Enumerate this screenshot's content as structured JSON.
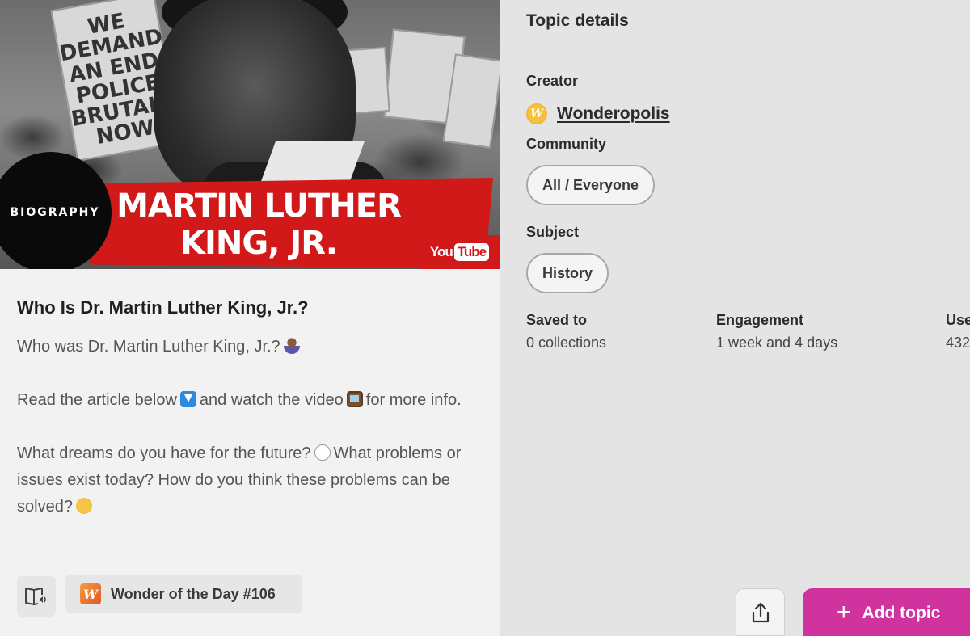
{
  "card": {
    "thumbnail": {
      "badge": "BIOGRAPHY",
      "banner_title": "MARTIN LUTHER KING, JR.",
      "youtube_you": "You",
      "youtube_tube": "Tube",
      "sign_text": "WE DEMAND AN END POLICE BRUTALITY NOW"
    },
    "title": "Who Is Dr. Martin Luther King, Jr.?",
    "description": [
      "Who was Dr. Martin Luther King, Jr.?",
      "Read the article below",
      "and watch the video",
      "for more info.",
      "What dreams do you have for the future?",
      "What problems or issues exist today? How do you think these problems can be solved?"
    ],
    "emojis": [
      "person-icon",
      "down-arrow-icon",
      "tv-icon",
      "thought-bubble-icon",
      "thinking-face-icon"
    ],
    "source_label": "Wonder of the Day #106"
  },
  "panel": {
    "title": "Topic details",
    "creator_label": "Creator",
    "creator_name": "Wonderopolis",
    "community_label": "Community",
    "community_value": "All / Everyone",
    "subject_label": "Subject",
    "subject_value": "History",
    "stats": [
      {
        "label": "Saved to",
        "value": "0 collections"
      },
      {
        "label": "Engagement",
        "value": "1 week and 4 days"
      },
      {
        "label": "Use",
        "value": "432"
      }
    ],
    "add_button": "Add topic"
  },
  "colors": {
    "accent": "#d0329e",
    "banner_red": "#d21919",
    "panel_bg": "#e4e4e4",
    "card_bg": "#f2f2f2"
  }
}
